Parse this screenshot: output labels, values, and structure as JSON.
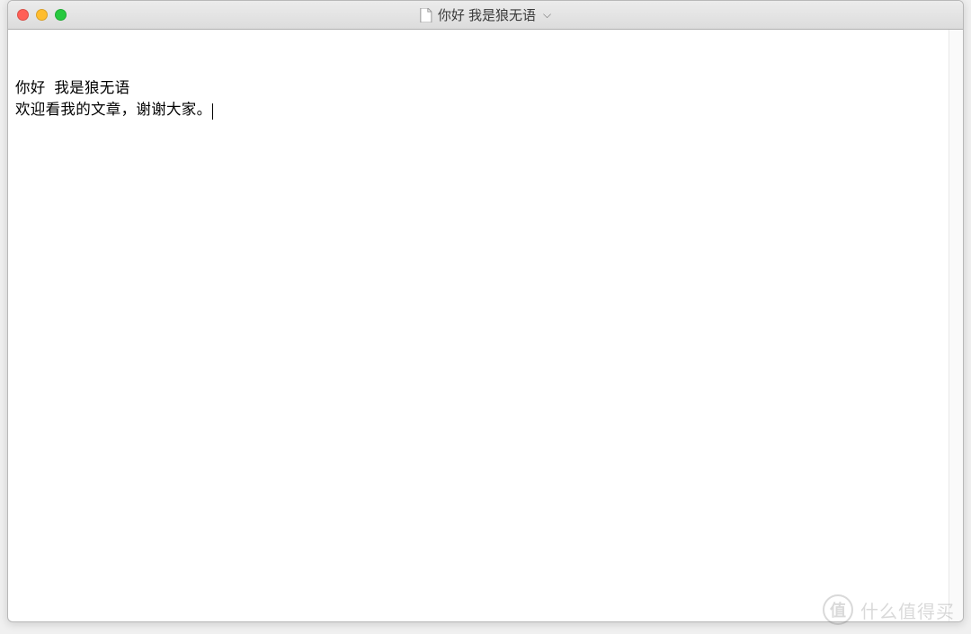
{
  "window": {
    "title": "你好 我是狼无语"
  },
  "editor": {
    "line1": "你好  我是狼无语",
    "line2": "欢迎看我的文章，谢谢大家。"
  },
  "watermark": {
    "badge": "值",
    "text": "什么值得买"
  }
}
